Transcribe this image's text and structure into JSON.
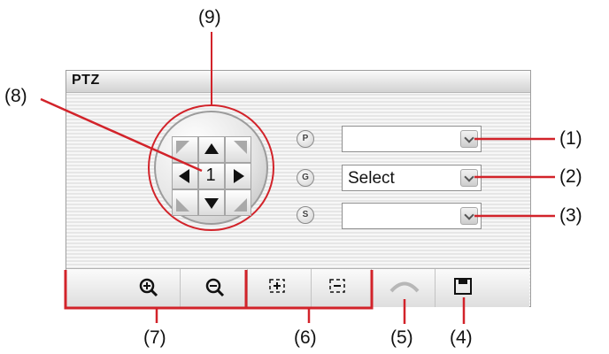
{
  "panel": {
    "title": "PTZ"
  },
  "dial": {
    "preset_number": "1"
  },
  "controls": {
    "preset": {
      "icon": "preset-p-icon",
      "value": ""
    },
    "group": {
      "icon": "group-g-icon",
      "value": "Select"
    },
    "sequence": {
      "icon": "sequence-s-icon",
      "value": ""
    }
  },
  "toolbar": {
    "zoom_in": "zoom-in-icon",
    "zoom_out": "zoom-out-icon",
    "focus_near": "focus-near-icon",
    "focus_far": "focus-far-icon",
    "undo": "undo-arrow-icon",
    "save": "save-disk-icon"
  },
  "callouts": {
    "c1": "(1)",
    "c2": "(2)",
    "c3": "(3)",
    "c4": "(4)",
    "c5": "(5)",
    "c6": "(6)",
    "c7": "(7)",
    "c8": "(8)",
    "c9": "(9)"
  },
  "colors": {
    "callout_line": "#d2232a",
    "panel_border": "#9e9e9e"
  }
}
